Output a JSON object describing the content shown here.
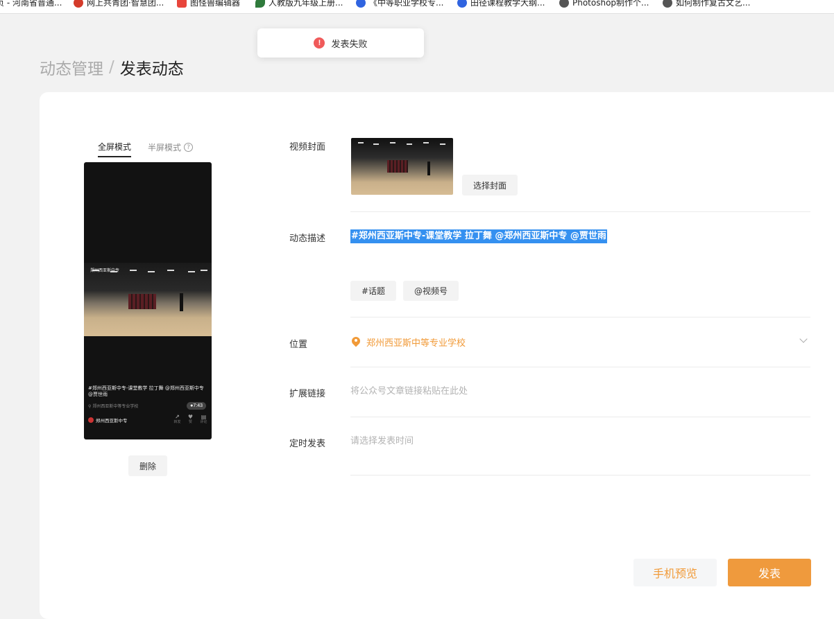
{
  "bookmarks": [
    {
      "label": "页 - 河南省普通...",
      "icon": "page-icon",
      "color": "#cccccc"
    },
    {
      "label": "网上共青团·智慧团...",
      "icon": "emblem-icon",
      "color": "#d43b2a"
    },
    {
      "label": "图怪兽编辑器",
      "icon": "tuguaishou-icon",
      "color": "#e8453c"
    },
    {
      "label": "人教版九年级上册...",
      "icon": "leaf-icon",
      "color": "#2f7a3c"
    },
    {
      "label": "《中等职业学校专...",
      "icon": "baidu-icon",
      "color": "#3064e0"
    },
    {
      "label": "田径课程教学大纲...",
      "icon": "baidu-icon",
      "color": "#3064e0"
    },
    {
      "label": "Photoshop制作个...",
      "icon": "globe-icon",
      "color": "#555555"
    },
    {
      "label": "如何制作复古文艺...",
      "icon": "globe-icon",
      "color": "#555555"
    }
  ],
  "toast": {
    "message": "发表失败",
    "icon": "error-icon",
    "color": "#f05a5a"
  },
  "breadcrumb": {
    "parent": "动态管理",
    "separator": "/",
    "current": "发表动态"
  },
  "preview": {
    "tabs": [
      {
        "label": "全屏模式",
        "active": true
      },
      {
        "label": "半屏模式",
        "active": false
      }
    ],
    "help_icon": "?",
    "overlay_brand": "郑州西亚斯中专",
    "caption": "#郑州西亚斯中专-课堂教学 拉丁舞 @郑州西亚斯中专 @贾世雨",
    "location": "郑州西亚斯中等专业学校",
    "duration": "7:43",
    "account": "郑州西亚斯中专",
    "actions": [
      {
        "icon": "share-icon",
        "glyph": "↗",
        "label": "转发"
      },
      {
        "icon": "heart-icon",
        "glyph": "♥",
        "label": "赞"
      },
      {
        "icon": "comment-icon",
        "glyph": "▤",
        "label": "评论"
      }
    ],
    "delete_label": "删除"
  },
  "form": {
    "cover": {
      "label": "视频封面",
      "button": "选择封面"
    },
    "description": {
      "label": "动态描述",
      "text": "#郑州西亚斯中专-课堂教学 拉丁舞 @郑州西亚斯中专 @贾世雨",
      "tag_buttons": [
        "#话题",
        "@视频号"
      ]
    },
    "location": {
      "label": "位置",
      "value": "郑州西亚斯中等专业学校",
      "color": "#f19a38"
    },
    "link": {
      "label": "扩展链接",
      "placeholder": "将公众号文章链接粘贴在此处"
    },
    "schedule": {
      "label": "定时发表",
      "placeholder": "请选择发表时间"
    }
  },
  "footer": {
    "preview_label": "手机预览",
    "publish_label": "发表",
    "accent": "#ef9a3d"
  }
}
